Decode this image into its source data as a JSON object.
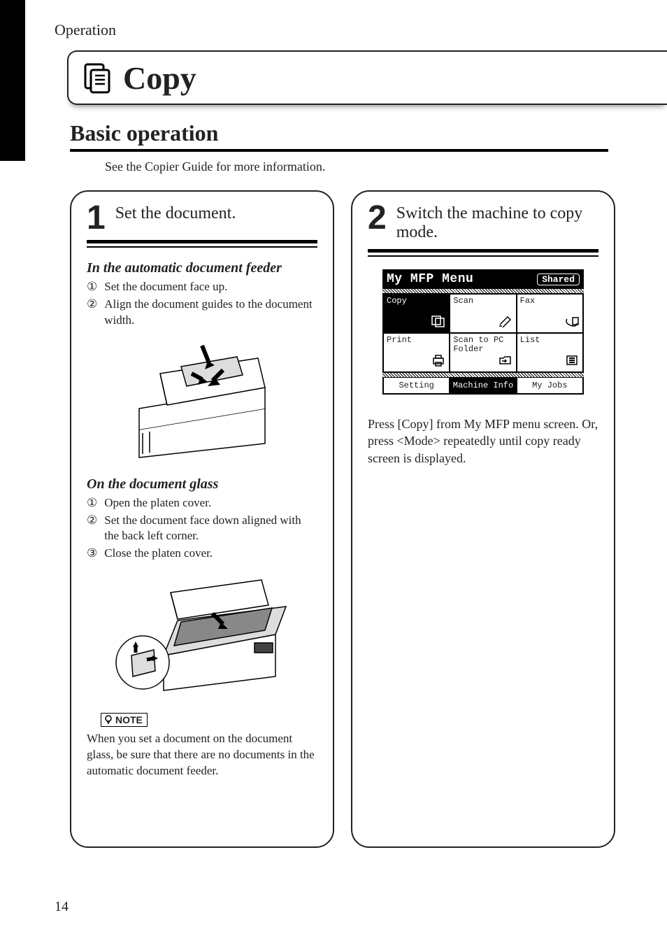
{
  "header": {
    "operation": "Operation"
  },
  "title": "Copy",
  "subheading": "Basic operation",
  "intro": "See the Copier Guide for more information.",
  "step1": {
    "num": "1",
    "title": "Set the document.",
    "adf": {
      "heading": "In the automatic document feeder",
      "items": [
        {
          "n": "①",
          "t": "Set the document face up."
        },
        {
          "n": "②",
          "t": "Align the document guides to the document width."
        }
      ]
    },
    "glass": {
      "heading": "On the document glass",
      "items": [
        {
          "n": "①",
          "t": "Open the platen cover."
        },
        {
          "n": "②",
          "t": "Set the document face down aligned with the back left corner."
        },
        {
          "n": "③",
          "t": "Close the  platen cover."
        }
      ]
    },
    "note_label": "NOTE",
    "note_text": "When you set a document on the document glass, be sure that there are no documents in the automatic document feeder."
  },
  "step2": {
    "num": "2",
    "title": "Switch the machine to copy mode.",
    "lcd": {
      "menu_title": "My MFP Menu",
      "shared": "Shared",
      "row1": [
        {
          "label": "Copy"
        },
        {
          "label": "Scan"
        },
        {
          "label": "Fax"
        }
      ],
      "row2": [
        {
          "label": "Print"
        },
        {
          "label": "Scan to PC Folder"
        },
        {
          "label": "List"
        }
      ],
      "bottom": [
        {
          "label": "Setting"
        },
        {
          "label": "Machine Info"
        },
        {
          "label": "My Jobs"
        }
      ]
    },
    "desc": "Press [Copy] from My MFP menu screen.  Or, press <Mode> repeatedly until copy ready screen is displayed."
  },
  "page_number": "14"
}
